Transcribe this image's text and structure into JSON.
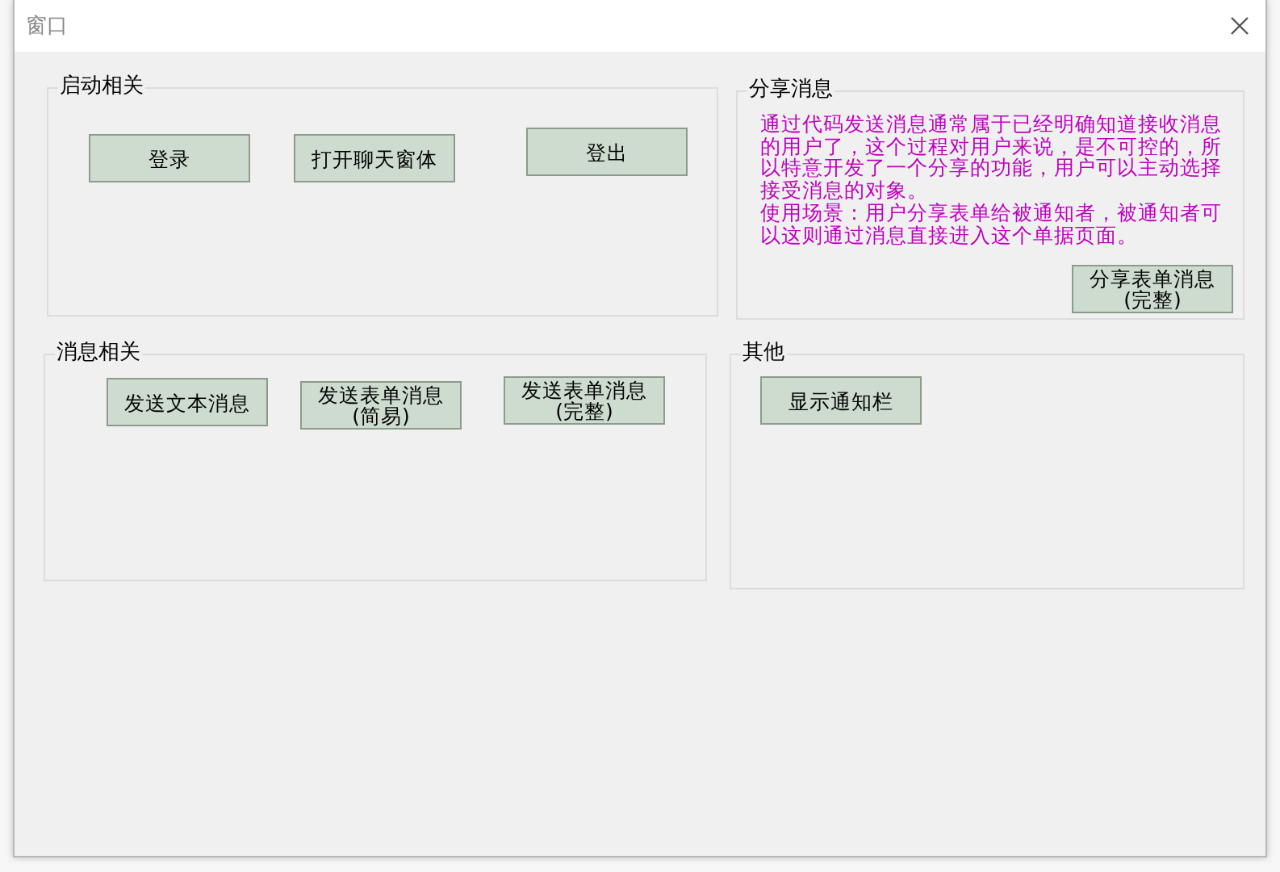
{
  "window": {
    "title": "窗口"
  },
  "groups": [
    {
      "title": "启动相关",
      "buttons": [
        {
          "label": "登录"
        },
        {
          "label": "打开聊天窗体"
        },
        {
          "label": "登出"
        }
      ]
    },
    {
      "title": "分享消息",
      "message": [
        "通过代码发送消息通常属于已经明确知道接收消息的用户了，这个过程对用户来说，是不可控的，所以特意开发了一个分享的功能，用户可以主动选择接受消息的对象。",
        "使用场景：用户分享表单给被通知者，被通知者可以这则通过消息直接进入这个单据页面。"
      ],
      "buttons": [
        {
          "label": "分享表单消息\n(完整)"
        }
      ]
    },
    {
      "title": "消息相关",
      "buttons": [
        {
          "label": "发送文本消息"
        },
        {
          "label": "发送表单消息\n(简易)"
        },
        {
          "label": "发送表单消息\n(完整)"
        }
      ]
    },
    {
      "title": "其他",
      "buttons": [
        {
          "label": "显示通知栏"
        }
      ]
    }
  ]
}
